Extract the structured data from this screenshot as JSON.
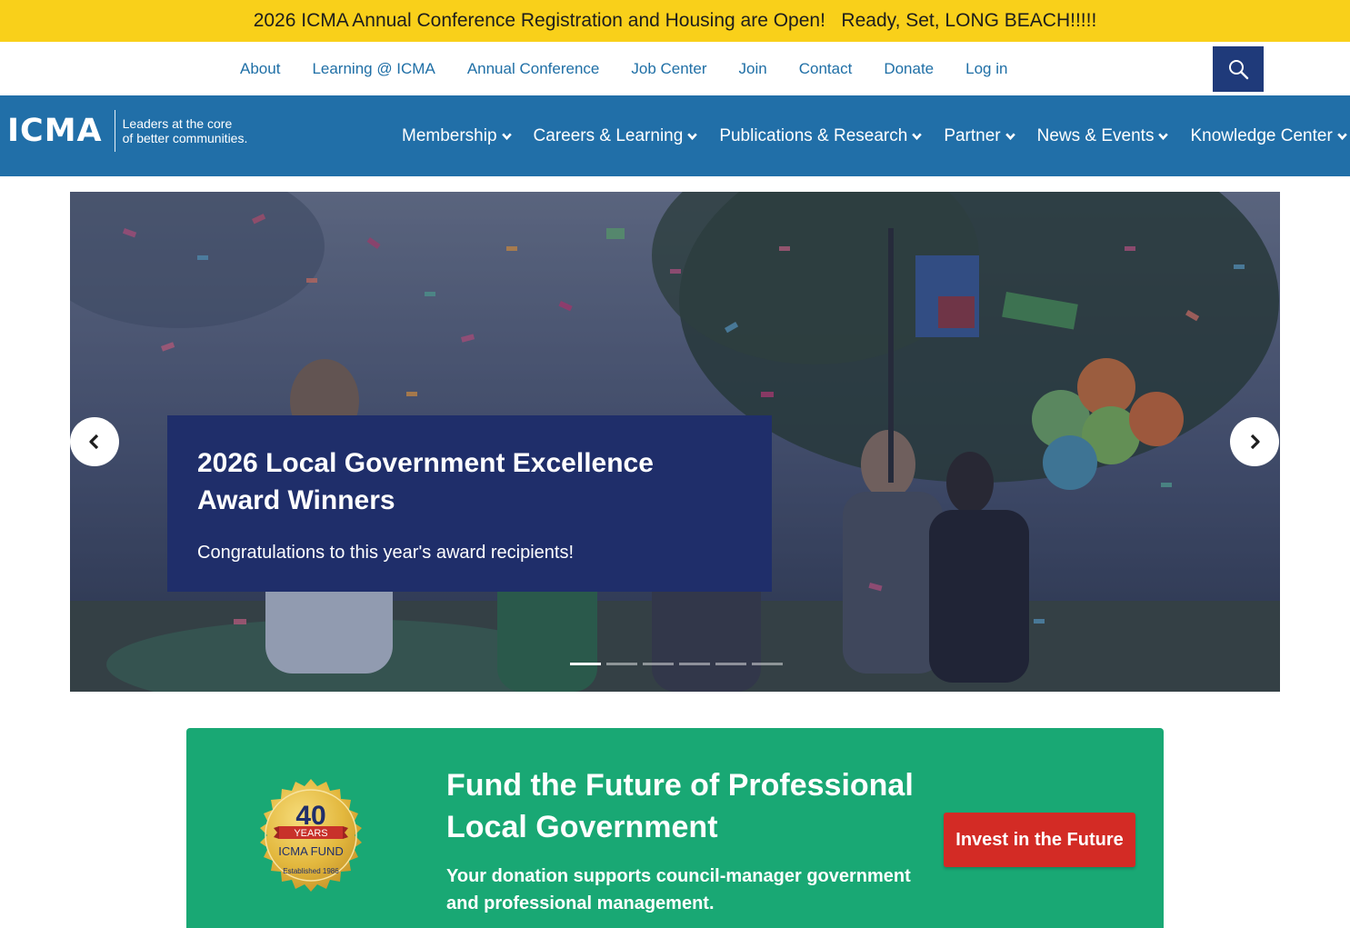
{
  "announcement": {
    "text": "2026 ICMA Annual Conference Registration and Housing are Open!   Ready, Set, LONG BEACH!!!!!"
  },
  "utility_nav": {
    "items": [
      {
        "label": "About"
      },
      {
        "label": "Learning @ ICMA"
      },
      {
        "label": "Annual Conference"
      },
      {
        "label": "Job Center"
      },
      {
        "label": "Join"
      },
      {
        "label": "Contact"
      },
      {
        "label": "Donate"
      },
      {
        "label": "Log in"
      }
    ],
    "search_icon": "search-icon"
  },
  "logo": {
    "mark": "ICMA",
    "tagline_line1": "Leaders at the core",
    "tagline_line2": "of better communities."
  },
  "main_nav": {
    "items": [
      {
        "label": "Membership"
      },
      {
        "label": "Careers & Learning"
      },
      {
        "label": "Publications & Research"
      },
      {
        "label": "Partner"
      },
      {
        "label": "News & Events"
      },
      {
        "label": "Knowledge Center"
      }
    ],
    "chevron_icon": "chevron-down-icon"
  },
  "hero": {
    "title": "2026 Local Government Excellence Award Winners",
    "text": "Congratulations to this year's award recipients!",
    "prev_icon": "chevron-left-icon",
    "next_icon": "chevron-right-icon",
    "slide_count": 6,
    "active_slide": 1
  },
  "fund": {
    "badge": {
      "number": "40",
      "years": "YEARS",
      "name": "ICMA FUND",
      "established": "Established 1986"
    },
    "title": "Fund the Future of Professional Local Government",
    "text": "Your donation supports council-manager government and professional management.",
    "button": "Invest in the Future"
  },
  "colors": {
    "announcement_bg": "#f9d01a",
    "nav_bg": "#216fa8",
    "search_bg": "#1f3a7a",
    "slide_card_bg": "#1f2e6a",
    "fund_bg": "#19a874",
    "cta_bg": "#d32b25"
  }
}
